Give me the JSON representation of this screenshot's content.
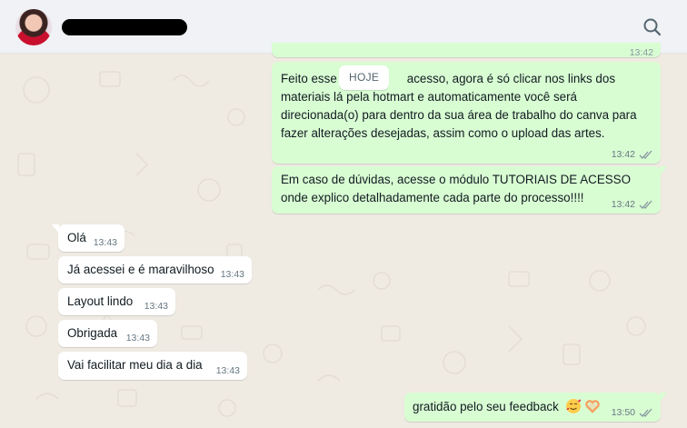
{
  "header": {
    "avatar_alt": "contact photo",
    "search_icon": "search-icon"
  },
  "date_divider": "HOJE",
  "messages": [
    {
      "id": "m0",
      "direction": "out",
      "partial_time": "13:42"
    },
    {
      "id": "m1",
      "direction": "out",
      "lines": [
        "Feito esse",
        "acesso, agora é só clicar nos links dos",
        "materiais lá pela hotmart e automaticamente você será",
        "direcionada(o) para dentro da sua área de trabalho do canva para",
        "fazer alterações desejadas, assim como o upload das artes."
      ],
      "time": "13:42",
      "status": "read"
    },
    {
      "id": "m2",
      "direction": "out",
      "lines": [
        "Em caso de dúvidas, acesse o módulo TUTORIAIS DE ACESSO",
        "onde explico detalhadamente cada parte do processo!!!!"
      ],
      "time": "13:42",
      "status": "read"
    },
    {
      "id": "m3",
      "direction": "in",
      "text": "Olá",
      "time": "13:43"
    },
    {
      "id": "m4",
      "direction": "in",
      "text": "Já acessei e é maravilhoso",
      "time": "13:43"
    },
    {
      "id": "m5",
      "direction": "in",
      "text": "Layout lindo",
      "time": "13:43"
    },
    {
      "id": "m6",
      "direction": "in",
      "text": "Obrigada",
      "time": "13:43"
    },
    {
      "id": "m7",
      "direction": "in",
      "text": "Vai facilitar meu dia a dia",
      "time": "13:43"
    },
    {
      "id": "m8",
      "direction": "out",
      "text": "gratidão pelo seu feedback",
      "emojis": [
        "smiling-face-with-hearts-emoji",
        "heart-hands-emoji"
      ],
      "time": "13:50",
      "status": "read"
    }
  ],
  "colors": {
    "chat_bg": "#efeae2",
    "outgoing_bubble": "#d9fdd3",
    "incoming_bubble": "#ffffff",
    "header_bg": "#f0f2f5",
    "read_ticks": "#8696a0"
  }
}
